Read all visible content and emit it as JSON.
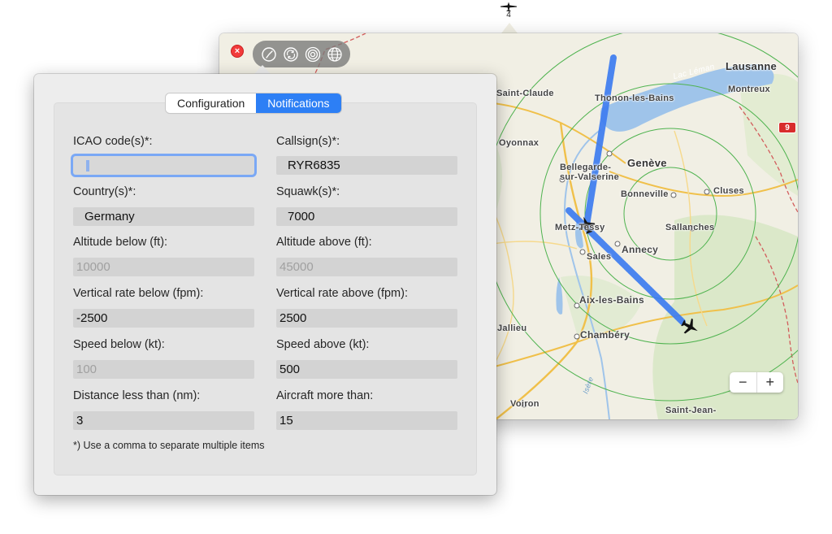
{
  "status_item": {
    "icon": "airplane-icon",
    "count": "4"
  },
  "map": {
    "toolbar": {
      "icons": [
        "compass-icon",
        "sync-icon",
        "target-icon",
        "globe-icon"
      ]
    },
    "labels": {
      "lausanne": "Lausanne",
      "montreux": "Montreux",
      "lac_leman": "Lac Léman",
      "saint_claude": "Saint-Claude",
      "thonon": "Thonon-les-Bains",
      "oyonnax": "Oyonnax",
      "bellegarde_1": "Bellegarde-",
      "bellegarde_2": "sur-Valserine",
      "geneve": "Genève",
      "bonneville": "Bonneville",
      "cluses": "Cluses",
      "sallanches": "Sallanches",
      "metz_tessy": "Metz-Tessy",
      "annecy": "Annecy",
      "sales": "Sales",
      "aix_les_bains": "Aix-les-Bains",
      "jallieu": "Jallieu",
      "chambery": "Chambéry",
      "voiron": "Voiron",
      "saint_jean": "Saint-Jean-",
      "isere": "Isère"
    },
    "road_badge": "9",
    "zoom": {
      "minus": "−",
      "plus": "+"
    },
    "colors": {
      "track": "#3d7cf0",
      "range_rings": "#4fb34f",
      "lake": "#9fc4ea"
    }
  },
  "settings": {
    "tabs": [
      {
        "label": "Configuration",
        "active": false
      },
      {
        "label": "Notifications",
        "active": true
      }
    ],
    "fields": {
      "icao": {
        "label": "ICAO code(s)*:",
        "value": ""
      },
      "callsign": {
        "label": "Callsign(s)*:",
        "value": "RYR6835"
      },
      "country": {
        "label": "Country(s)*:",
        "value": "Germany"
      },
      "squawk": {
        "label": "Squawk(s)*:",
        "value": "7000"
      },
      "alt_below": {
        "label": "Altitude below (ft):",
        "placeholder": "10000"
      },
      "alt_above": {
        "label": "Altitude above (ft):",
        "placeholder": "45000"
      },
      "vr_below": {
        "label": "Vertical rate below (fpm):",
        "value": "-2500"
      },
      "vr_above": {
        "label": "Vertical rate above (fpm):",
        "value": "2500"
      },
      "spd_below": {
        "label": "Speed below (kt):",
        "placeholder": "100"
      },
      "spd_above": {
        "label": "Speed above (kt):",
        "value": "500"
      },
      "dist": {
        "label": "Distance less than (nm):",
        "value": "3"
      },
      "aircraft": {
        "label": "Aircraft more than:",
        "value": "15"
      }
    },
    "footnote": "*) Use a comma to separate multiple items"
  }
}
